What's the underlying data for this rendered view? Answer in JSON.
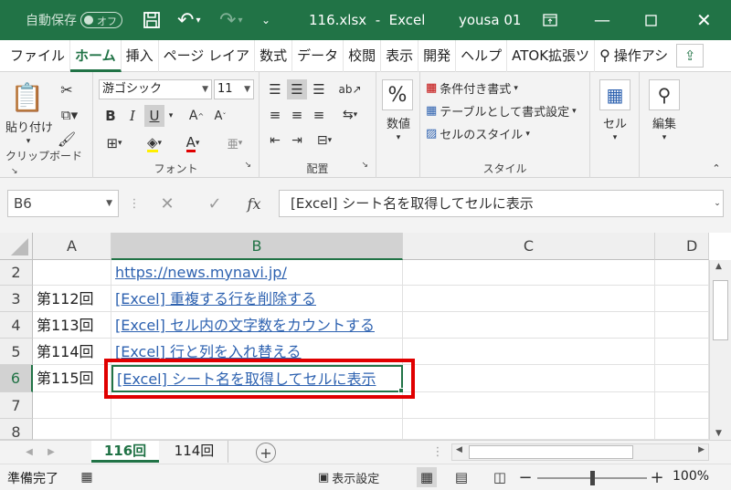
{
  "titlebar": {
    "autosave_label": "自動保存",
    "autosave_state": "オフ",
    "filename": "116.xlsx",
    "separator": "-",
    "app": "Excel",
    "user": "yousa 01"
  },
  "menu": {
    "tabs": [
      "ファイル",
      "ホーム",
      "挿入",
      "ページ レイア",
      "数式",
      "データ",
      "校閲",
      "表示",
      "開発",
      "ヘルプ",
      "ATOK拡張ツ"
    ],
    "active_tab": "ホーム",
    "search_label": "操作アシ"
  },
  "ribbon": {
    "clipboard": {
      "paste_label": "貼り付け",
      "group_label": "クリップボード"
    },
    "font": {
      "font_name": "游ゴシック",
      "font_size": "11",
      "group_label": "フォント",
      "bold": "B",
      "italic": "I",
      "underline": "U"
    },
    "alignment": {
      "group_label": "配置"
    },
    "number": {
      "label": "数値"
    },
    "styles": {
      "conditional_format": "条件付き書式",
      "format_as_table": "テーブルとして書式設定",
      "cell_styles": "セルのスタイル",
      "group_label": "スタイル"
    },
    "cells": {
      "label": "セル"
    },
    "editing": {
      "label": "編集"
    }
  },
  "formula_bar": {
    "name_box": "B6",
    "fx": "fx",
    "content": "[Excel] シート名を取得してセルに表示"
  },
  "grid": {
    "columns": [
      "A",
      "B",
      "C",
      "D"
    ],
    "selected_column": "B",
    "rows": [
      {
        "num": "2",
        "a": "",
        "b": "https://news.mynavi.jp/"
      },
      {
        "num": "3",
        "a": "第112回",
        "b": "[Excel] 重複する行を削除する"
      },
      {
        "num": "4",
        "a": "第113回",
        "b": "[Excel] セル内の文字数をカウントする"
      },
      {
        "num": "5",
        "a": "第114回",
        "b": "[Excel] 行と列を入れ替える"
      },
      {
        "num": "6",
        "a": "第115回",
        "b": "[Excel] シート名を取得してセルに表示"
      },
      {
        "num": "7",
        "a": "",
        "b": ""
      },
      {
        "num": "8",
        "a": "",
        "b": ""
      }
    ],
    "selected_row": "6",
    "highlight_color": "#e00000"
  },
  "sheets": {
    "tabs": [
      "116回",
      "114回"
    ],
    "active": "116回"
  },
  "status": {
    "ready": "準備完了",
    "display_settings": "表示設定",
    "zoom": "100%"
  }
}
